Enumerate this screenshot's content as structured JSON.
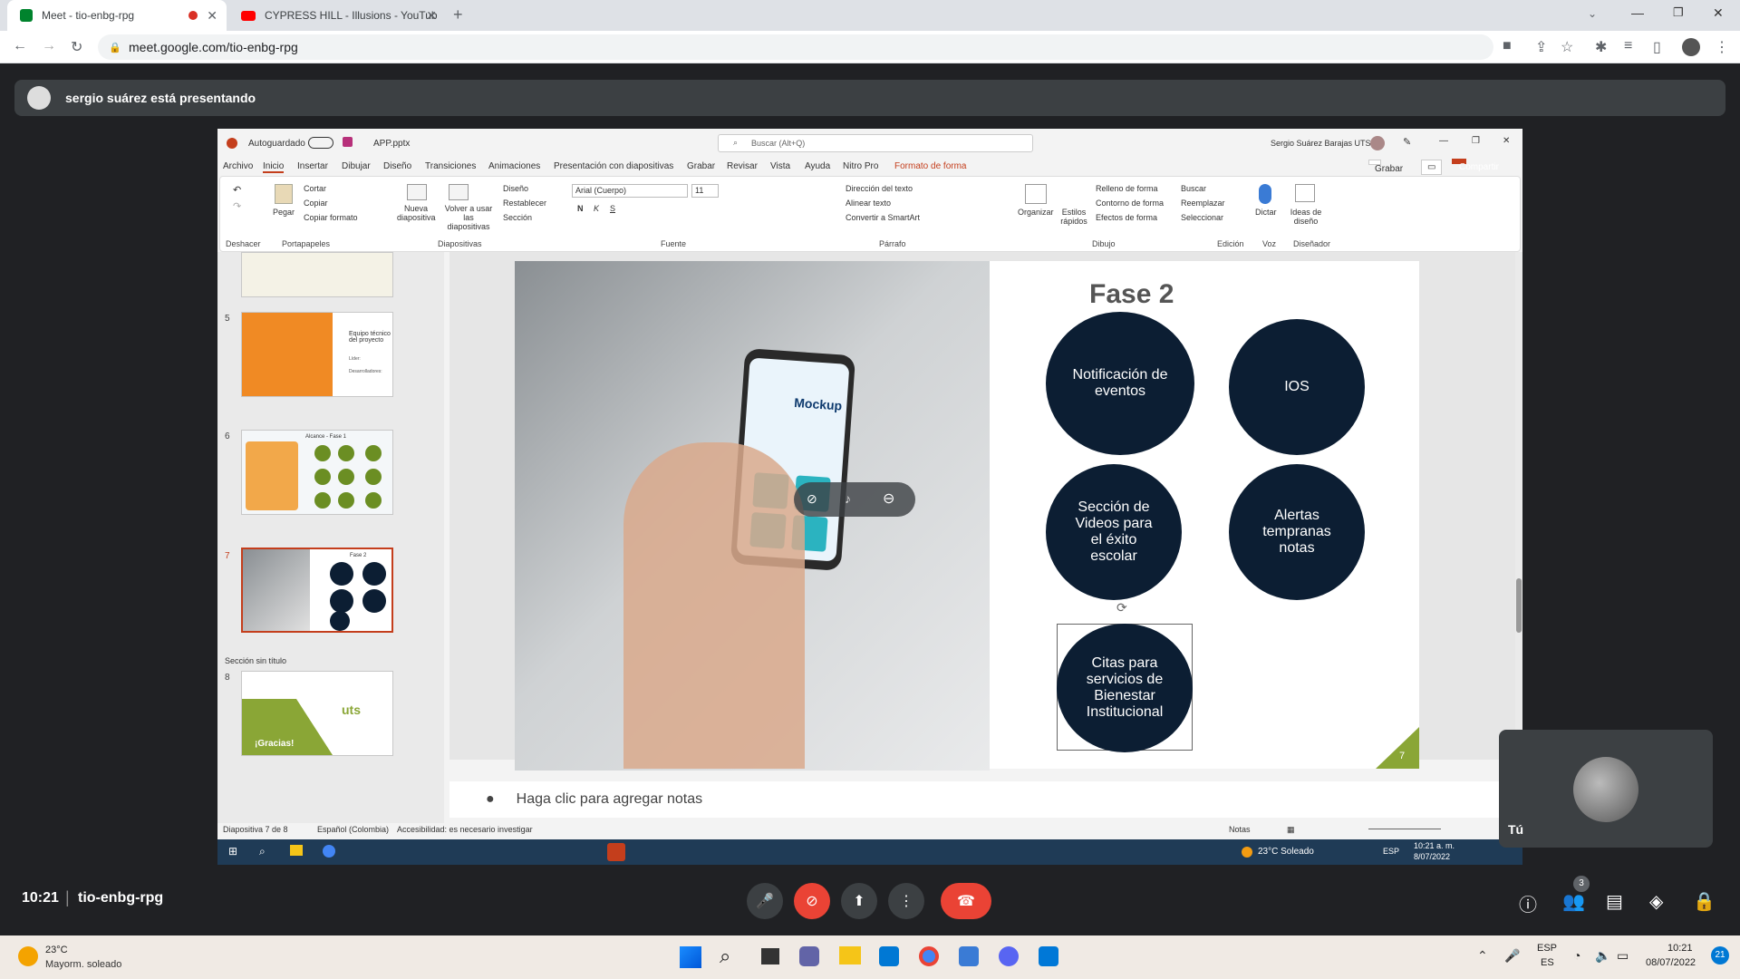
{
  "browser": {
    "tabs": [
      {
        "title": "Meet - tio-enbg-rpg"
      },
      {
        "title": "CYPRESS HILL - Illusions - YouTub"
      }
    ],
    "url": "meet.google.com/tio-enbg-rpg"
  },
  "meet": {
    "presenting": "sergio suárez está presentando",
    "time": "10:21",
    "code": "tio-enbg-rpg",
    "you_label": "Tú",
    "people_count": "3"
  },
  "ppt": {
    "autosave": "Autoguardado",
    "filename": "APP.pptx",
    "search": "Buscar (Alt+Q)",
    "user": "Sergio Suárez Barajas UTS",
    "record": "Grabar",
    "share": "Compartir",
    "menu": [
      "Archivo",
      "Inicio",
      "Insertar",
      "Dibujar",
      "Diseño",
      "Transiciones",
      "Animaciones",
      "Presentación con diapositivas",
      "Grabar",
      "Revisar",
      "Vista",
      "Ayuda",
      "Nitro Pro",
      "Formato de forma"
    ],
    "ribbon_groups": [
      "Deshacer",
      "Portapapeles",
      "Diapositivas",
      "Fuente",
      "Párrafo",
      "Dibujo",
      "Edición",
      "Voz",
      "Diseñador"
    ],
    "ribbon_items": {
      "paste": "Pegar",
      "cut": "Cortar",
      "copy": "Copiar",
      "format": "Copiar formato",
      "new_slide": "Nueva diapositiva",
      "reuse": "Volver a usar las diapositivas",
      "design": "Diseño",
      "reset": "Restablecer",
      "section": "Sección",
      "font": "Arial (Cuerpo)",
      "size": "11",
      "text_dir": "Dirección del texto",
      "align_text": "Alinear texto",
      "smartart": "Convertir a SmartArt",
      "organize": "Organizar",
      "quick_styles": "Estilos rápidos",
      "fill": "Relleno de forma",
      "outline": "Contorno de forma",
      "effects": "Efectos de forma",
      "find": "Buscar",
      "replace": "Reemplazar",
      "select": "Seleccionar",
      "dictate": "Dictar",
      "ideas": "Ideas de diseño"
    },
    "thumbs": [
      {
        "num": "5",
        "title": "Equipo técnico del proyecto",
        "lines": [
          "Líder:",
          "Desarrolladores:"
        ]
      },
      {
        "num": "6",
        "title": "Alcance - Fase 1"
      },
      {
        "num": "7",
        "title": "Fase 2"
      },
      {
        "num": "8",
        "title": "¡Gracias!",
        "brand": "uts"
      }
    ],
    "section_label": "Sección sin título",
    "slide_title": "Fase 2",
    "circles": [
      "Notificación de eventos",
      "IOS",
      "Sección de Videos para el éxito escolar",
      "Alertas tempranas notas",
      "Citas para servicios de Bienestar Institucional"
    ],
    "slide_number": "7",
    "notes": "Haga clic para agregar notas",
    "status": {
      "slide": "Diapositiva 7 de 8",
      "lang": "Español (Colombia)",
      "access": "Accesibilidad: es necesario investigar",
      "notes_btn": "Notas"
    },
    "mockup": "Mockup",
    "inner_weather": "23°C  Soleado",
    "inner_time": "10:21 a. m.",
    "inner_date": "8/07/2022",
    "inner_lang": "ESP"
  },
  "taskbar": {
    "temp": "23°C",
    "weather": "Mayorm. soleado",
    "lang": "ESP",
    "lang2": "ES",
    "time": "10:21",
    "date": "08/07/2022",
    "notif": "21"
  },
  "colors": {
    "meet_red": "#ea4335",
    "ppt_orange": "#c43e1c",
    "circle": "#0c1e33"
  }
}
